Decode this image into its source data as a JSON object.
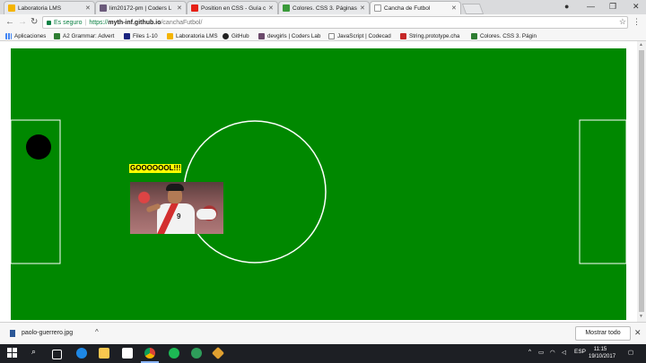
{
  "browser": {
    "tabs": [
      {
        "label": "Laboratoria LMS",
        "icon": "laboratoria-icon",
        "color": "#f4b400",
        "active": false
      },
      {
        "label": "lim20172-pm | Coders L",
        "icon": "github-icon",
        "color": "#6b5b7b",
        "active": false
      },
      {
        "label": "Position en CSS - Guía c",
        "icon": "youtube-icon",
        "color": "#e62117",
        "active": false
      },
      {
        "label": "Colores. CSS 3. Páginas w",
        "icon": "check-icon",
        "color": "#3a9a3a",
        "active": false
      },
      {
        "label": "Cancha de Futbol",
        "icon": "blank-page-icon",
        "color": "#ffffff",
        "active": true
      }
    ],
    "address": {
      "secure_label": "Es seguro",
      "scheme": "https://",
      "host": "myth-inf.github.io",
      "path": "/canchaFutbol/"
    },
    "bookmarks": [
      {
        "label": "Aplicaciones",
        "icon": "apps-grid-icon",
        "color": "#4285f4"
      },
      {
        "label": "A2 Grammar: Advert",
        "icon": "check-icon",
        "color": "#2e7d32"
      },
      {
        "label": "Files 1-10",
        "icon": "files-icon",
        "color": "#1a237e"
      },
      {
        "label": "Laboratoria LMS",
        "icon": "laboratoria-icon",
        "color": "#f4b400"
      },
      {
        "label": "GitHub",
        "icon": "github-icon",
        "color": "#222222"
      },
      {
        "label": "devgirls | Coders Lab",
        "icon": "devgirls-icon",
        "color": "#6b4a6b"
      },
      {
        "label": "JavaScript | Codecad",
        "icon": "page-icon",
        "color": "#888888"
      },
      {
        "label": "String.prototype.cha",
        "icon": "mdn-icon",
        "color": "#c62828"
      },
      {
        "label": "Colores. CSS 3. Págin",
        "icon": "check-icon",
        "color": "#2e7d32"
      }
    ]
  },
  "page": {
    "goal_text": "GOOOOOOL!!!",
    "field_color": "#008800",
    "line_color": "#ffffff",
    "goal_text_bg": "#ffff00",
    "ball_color": "#000000",
    "player_image": "player-celebration-photo"
  },
  "downloads": {
    "filename": "paolo-guerrero.jpg",
    "show_all": "Mostrar todo"
  },
  "taskbar": {
    "language": "ESP",
    "time": "11:15",
    "date": "19/10/2017"
  }
}
